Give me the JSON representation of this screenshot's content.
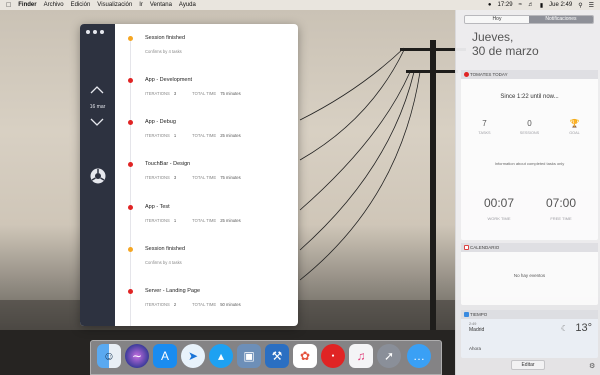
{
  "menubar": {
    "apple_icon": "apple-icon",
    "items": [
      "Finder",
      "Archivo",
      "Edición",
      "Visualización",
      "Ir",
      "Ventana",
      "Ayuda"
    ],
    "time": "17:29",
    "clock": "Jue 2:49"
  },
  "app": {
    "date_label": "16 mar",
    "entries": [
      {
        "title": "Session finished",
        "subtitle": "Confirms by 4 tasks",
        "color": "#f5a623"
      },
      {
        "title": "App - Development",
        "iter_label": "ITERATIONS",
        "iter": "3",
        "total_label": "TOTAL TIME",
        "total": "75 minutes",
        "color": "#e02424"
      },
      {
        "title": "App - Debug",
        "iter_label": "ITERATIONS",
        "iter": "1",
        "total_label": "TOTAL TIME",
        "total": "25 minutes",
        "color": "#e02424"
      },
      {
        "title": "TouchBar - Design",
        "iter_label": "ITERATIONS",
        "iter": "3",
        "total_label": "TOTAL TIME",
        "total": "75 minutes",
        "color": "#e02424"
      },
      {
        "title": "App - Test",
        "iter_label": "ITERATIONS",
        "iter": "1",
        "total_label": "TOTAL TIME",
        "total": "25 minutes",
        "color": "#e02424"
      },
      {
        "title": "Session finished",
        "subtitle": "Confirms by 4 tasks",
        "color": "#f5a623"
      },
      {
        "title": "Server - Landing Page",
        "iter_label": "ITERATIONS",
        "iter": "2",
        "total_label": "TOTAL TIME",
        "total": "50 minutes",
        "color": "#e02424"
      }
    ]
  },
  "nc": {
    "tab_today": "Hoy",
    "tab_notifications": "Notificaciones",
    "day_name": "Jueves,",
    "day_date": "30 de marzo",
    "tomates": {
      "header": "TOMATES TODAY",
      "since": "Since 1:22 until now...",
      "tasks_value": "7",
      "tasks_label": "TASKS",
      "sessions_value": "0",
      "sessions_label": "SESSIONS",
      "goal_label": "GOAL",
      "info": "Information about completed tasks only",
      "work_time": "00:07",
      "work_label": "WORK TIME",
      "free_time": "07:00",
      "free_label": "FREE TIME"
    },
    "calendar": {
      "header": "CALENDARIO",
      "empty": "No hay eventos"
    },
    "weather": {
      "header": "TIEMPO",
      "time": "2:49",
      "city": "Madrid",
      "temp": "13°",
      "now": "Ahora"
    },
    "edit": "Editar"
  },
  "dock": [
    "finder-icon",
    "siri-icon",
    "app-store-icon",
    "safari-icon",
    "twitter-icon",
    "preview-icon",
    "xcode-icon",
    "photos-icon",
    "tomato-app-icon",
    "itunes-icon",
    "launchpad-icon",
    "messages-icon"
  ]
}
